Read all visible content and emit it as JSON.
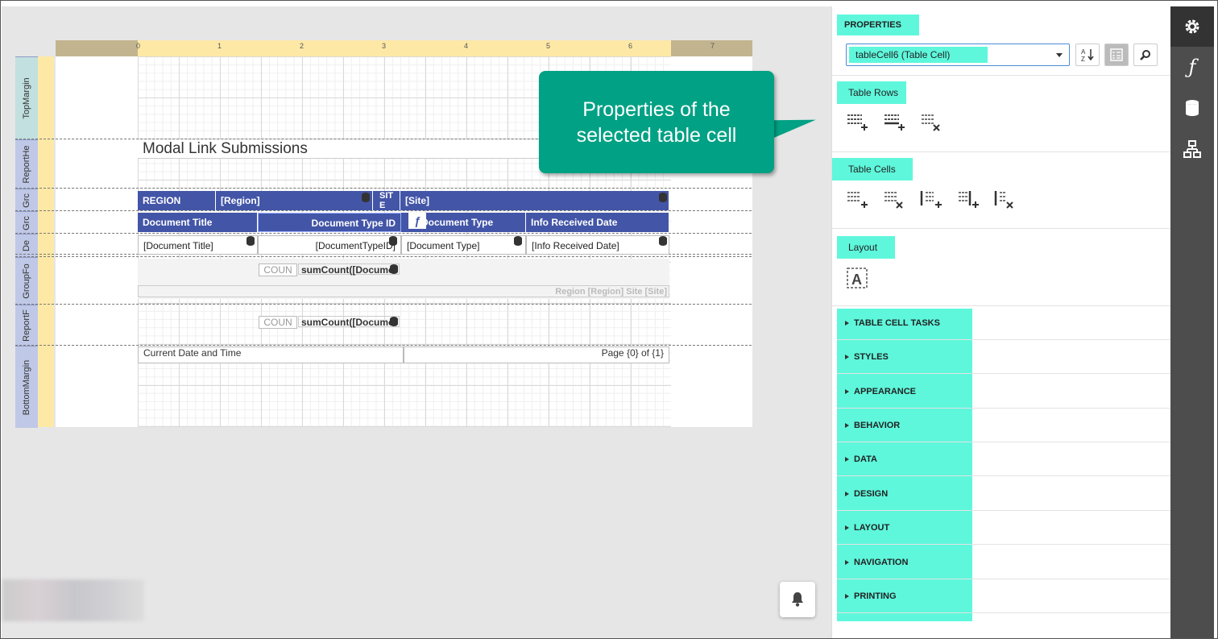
{
  "designer": {
    "ruler_numbers": [
      "0",
      "1",
      "2",
      "3",
      "4",
      "5",
      "6",
      "7"
    ],
    "bands": [
      "TopMargin",
      "ReportHe",
      "Grc",
      "Grc",
      "De",
      "GroupFo",
      "ReportF",
      "BottomMargin"
    ],
    "report_title": "Modal Link Submissions",
    "group_header": {
      "region_label": "REGION",
      "region_value": "[Region]",
      "site_label": "SIT E",
      "site_value": "[Site]"
    },
    "table_header": [
      "Document Title",
      "Document Type ID",
      "Document Type",
      "Info Received Date"
    ],
    "detail_row": [
      "[Document Title]",
      "[DocumentTypeID]",
      "[Document Type]",
      "[Info Received Date]"
    ],
    "group_footer": {
      "count_label": "COUN",
      "sum_value": "sumCount([Docume",
      "region_site": "Region [Region]  Site [Site]"
    },
    "report_footer": {
      "count_label": "COUN",
      "sum_value": "sumCount([Docume"
    },
    "bottom_margin": {
      "left": "Current Date and Time",
      "right": "Page {0} of {1}"
    },
    "fx_label": "ƒ"
  },
  "callout": {
    "line1": "Properties of the",
    "line2": "selected table cell",
    "color": "#00a184"
  },
  "properties": {
    "title": "PROPERTIES",
    "selected_component": "tableCell6 (Table Cell)",
    "sections": {
      "table_rows": "Table Rows",
      "table_cells": "Table Cells",
      "layout": "Layout"
    },
    "categories": [
      "TABLE CELL TASKS",
      "STYLES",
      "APPEARANCE",
      "BEHAVIOR",
      "DATA",
      "DESIGN",
      "LAYOUT",
      "NAVIGATION",
      "PRINTING"
    ],
    "highlight_color": "#5ef7dc"
  },
  "rightbar": {
    "items": [
      "gear-icon",
      "function-icon",
      "database-icon",
      "structure-icon"
    ],
    "fn_glyph": "ƒ"
  }
}
